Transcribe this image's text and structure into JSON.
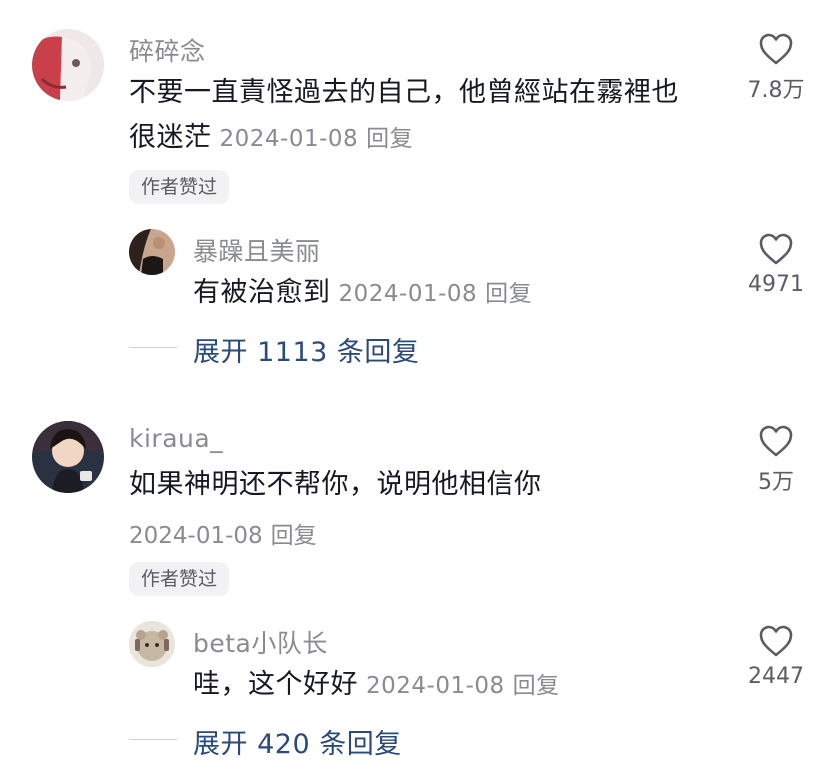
{
  "comments": [
    {
      "username": "碎碎念",
      "text_line1": "不要一直責怪過去的自己，他曾經站在霧裡也",
      "text_line2": "很迷茫",
      "date": "2024-01-08",
      "reply_label": "回复",
      "badge": "作者赞过",
      "likes": "7.8万",
      "reply": {
        "username": "暴躁且美丽",
        "text": "有被治愈到",
        "date": "2024-01-08",
        "reply_label": "回复",
        "likes": "4971"
      },
      "expand_label": "展开 1113 条回复"
    },
    {
      "username": "kiraua_",
      "text": "如果神明还不帮你，说明他相信你",
      "date": "2024-01-08",
      "reply_label": "回复",
      "badge": "作者赞过",
      "likes": "5万",
      "reply": {
        "username": "beta小队长",
        "text": "哇，这个好好",
        "date": "2024-01-08",
        "reply_label": "回复",
        "likes": "2447"
      },
      "expand_label": "展开 420 条回复"
    }
  ],
  "icons": {
    "like": "heart-outline-icon"
  },
  "colors": {
    "text": "#161823",
    "muted": "#8a8b91",
    "link": "#2b4a7c",
    "badge_bg": "#f2f2f4"
  }
}
